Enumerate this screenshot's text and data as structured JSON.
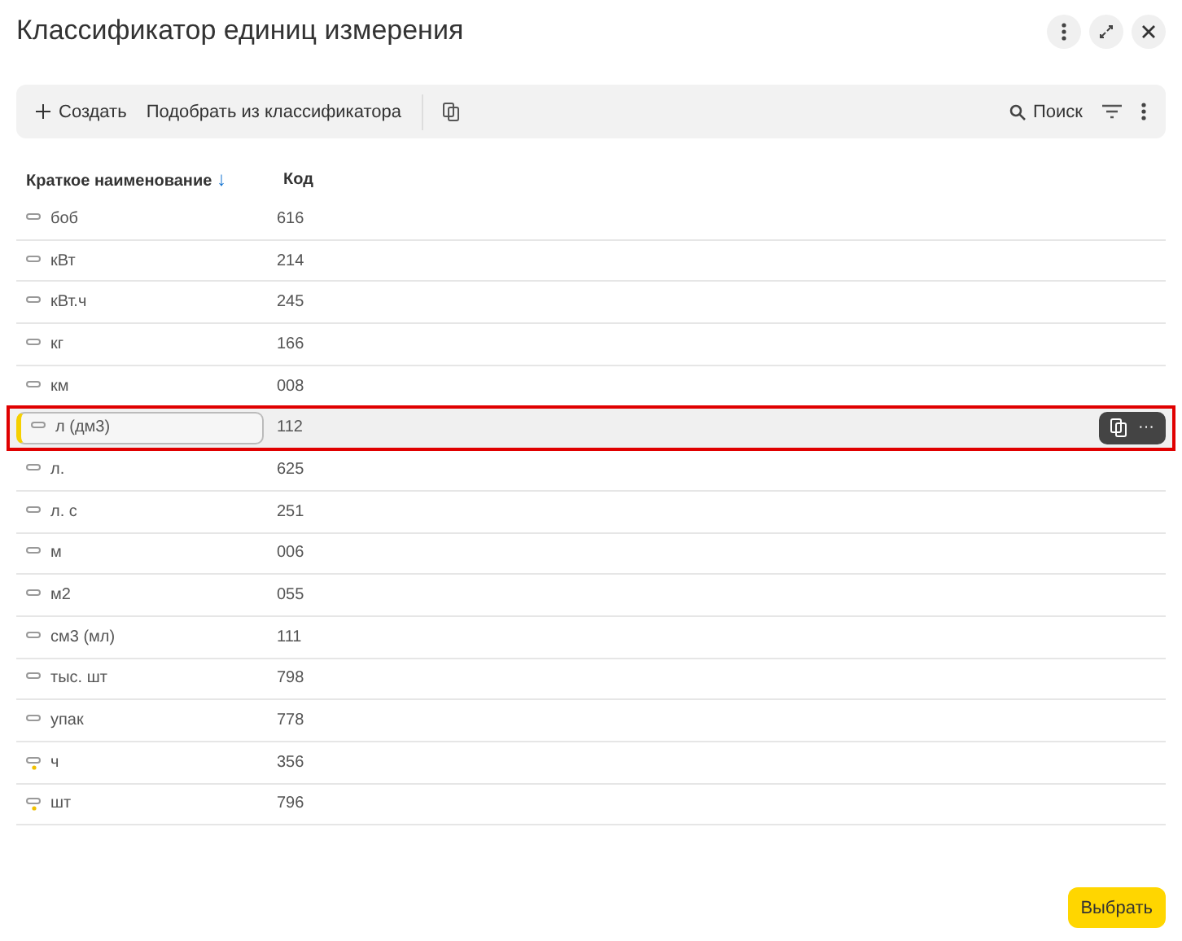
{
  "window": {
    "title": "Классификатор единиц измерения"
  },
  "toolbar": {
    "create": "Создать",
    "pick": "Подобрать из классификатора",
    "search": "Поиск"
  },
  "table": {
    "columns": [
      {
        "label": "Краткое наименование",
        "sort": "↓"
      },
      {
        "label": "Код"
      }
    ],
    "rows": [
      {
        "name": "боб",
        "code": "616",
        "selected": false,
        "modified": false
      },
      {
        "name": "кВт",
        "code": "214",
        "selected": false,
        "modified": false
      },
      {
        "name": "кВт.ч",
        "code": "245",
        "selected": false,
        "modified": false
      },
      {
        "name": "кг",
        "code": "166",
        "selected": false,
        "modified": false
      },
      {
        "name": "км",
        "code": "008",
        "selected": false,
        "modified": false
      },
      {
        "name": "л (дм3)",
        "code": "112",
        "selected": true,
        "modified": false
      },
      {
        "name": "л.",
        "code": "625",
        "selected": false,
        "modified": false
      },
      {
        "name": "л. с",
        "code": "251",
        "selected": false,
        "modified": false
      },
      {
        "name": "м",
        "code": "006",
        "selected": false,
        "modified": false
      },
      {
        "name": "м2",
        "code": "055",
        "selected": false,
        "modified": false
      },
      {
        "name": "см3 (мл)",
        "code": "111",
        "selected": false,
        "modified": false
      },
      {
        "name": "тыс. шт",
        "code": "798",
        "selected": false,
        "modified": false
      },
      {
        "name": "упак",
        "code": "778",
        "selected": false,
        "modified": false
      },
      {
        "name": "ч",
        "code": "356",
        "selected": false,
        "modified": true
      },
      {
        "name": "шт",
        "code": "796",
        "selected": false,
        "modified": true
      }
    ]
  },
  "row_actions": {
    "more": "···"
  },
  "footer": {
    "choose": "Выбрать"
  }
}
